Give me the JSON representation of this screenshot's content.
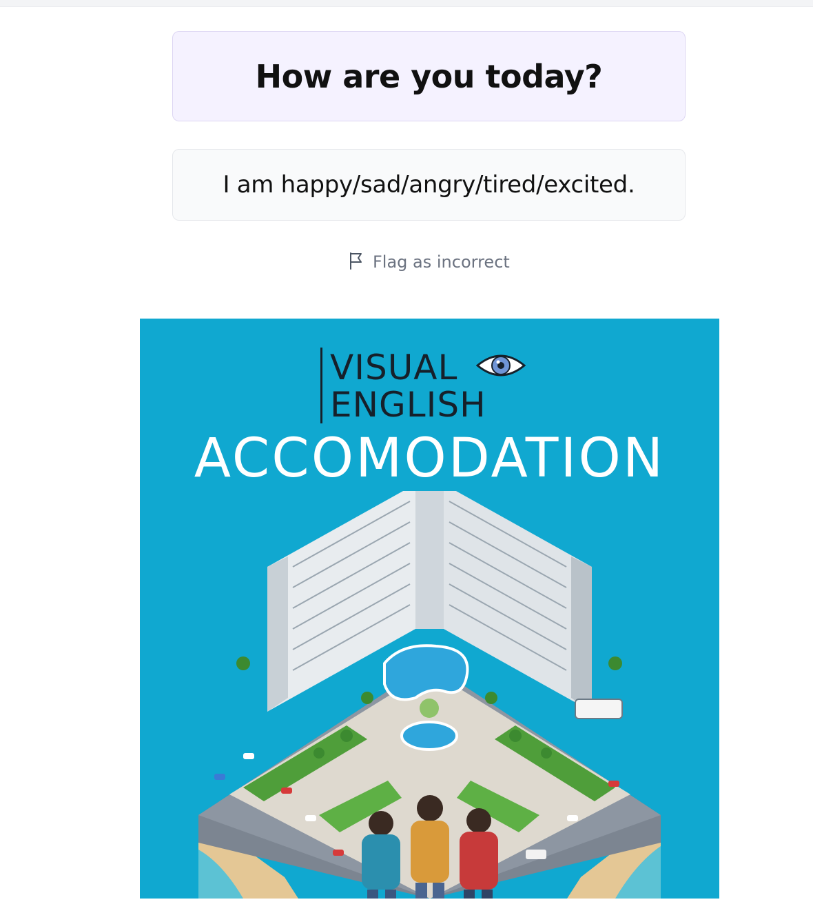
{
  "question": "How are you today?",
  "answer": "I am happy/sad/angry/tired/excited.",
  "flag": {
    "label": "Flag as incorrect",
    "icon": "flag-icon"
  },
  "image": {
    "brand_line1": "VISUAL",
    "brand_line2": "ENGLISH",
    "title": "ACCOMODATION",
    "background": "#10a8d0"
  }
}
